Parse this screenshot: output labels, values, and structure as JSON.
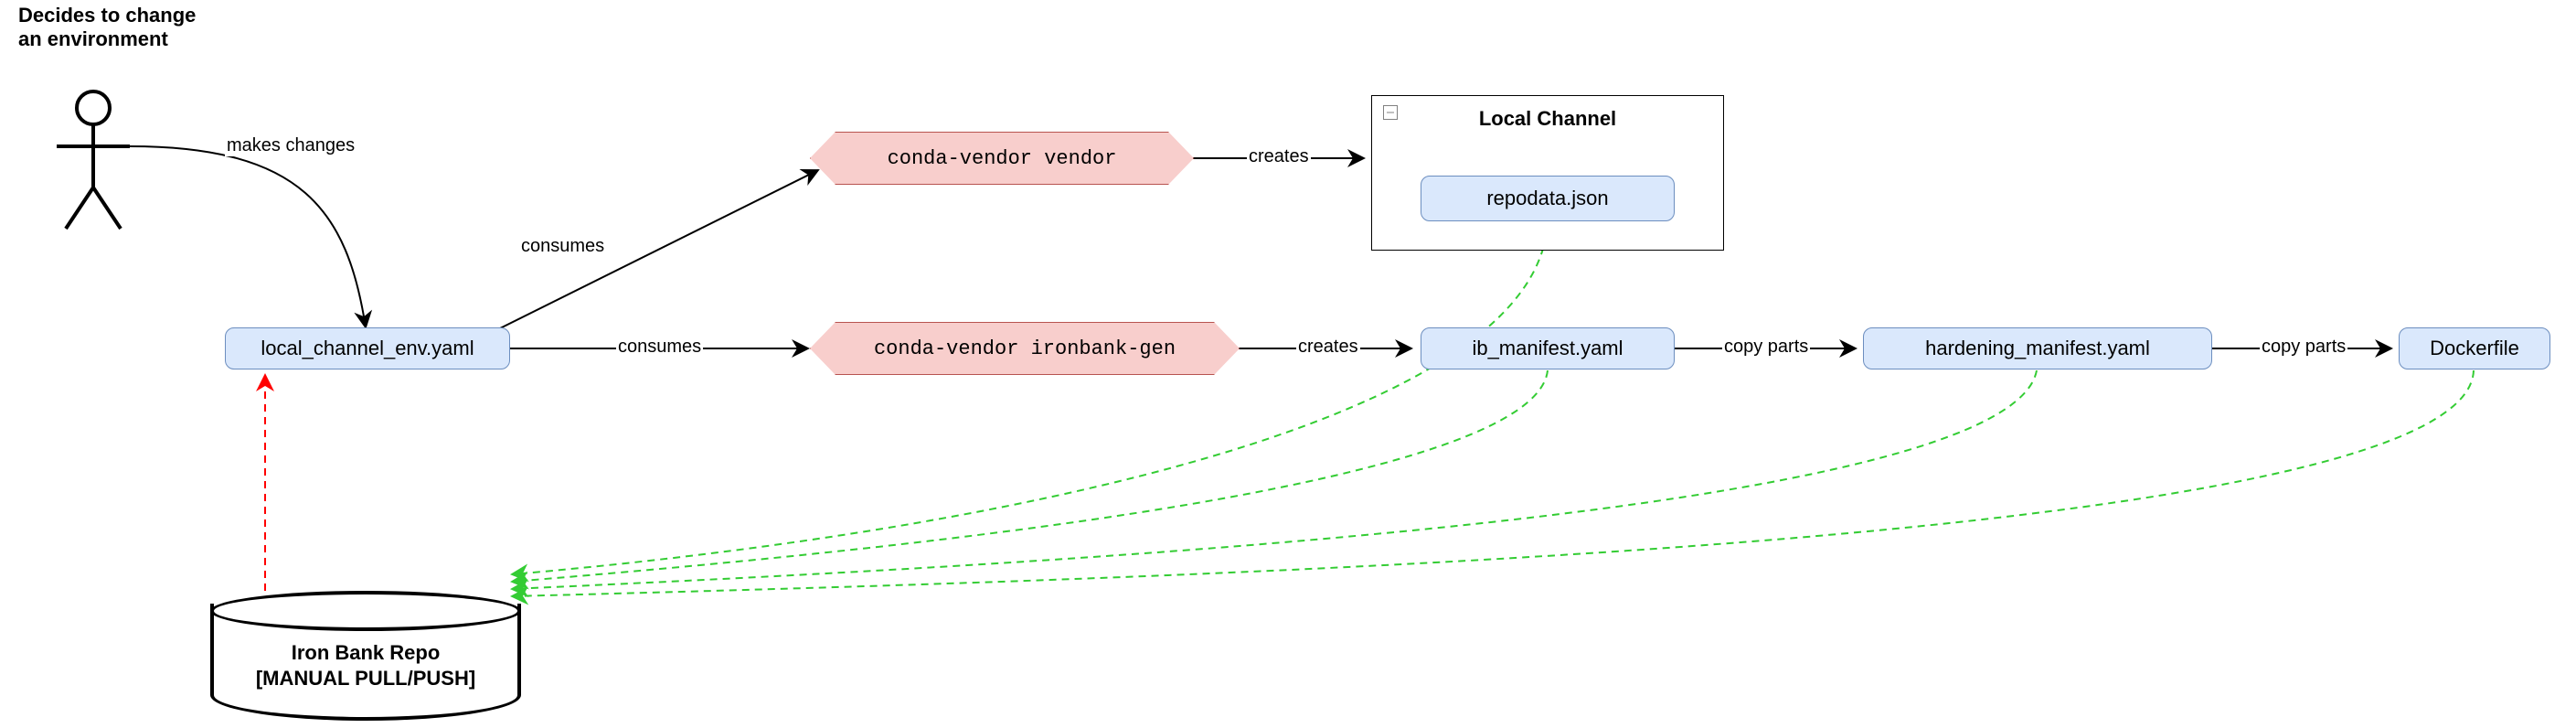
{
  "actor": {
    "title": "Decides to change\nan environment"
  },
  "nodes": {
    "local_channel_env": "local_channel_env.yaml",
    "vendor": "conda-vendor vendor",
    "ironbank_gen": "conda-vendor ironbank-gen",
    "local_channel_container": "Local Channel",
    "repodata": "repodata.json",
    "ib_manifest": "ib_manifest.yaml",
    "hardening_manifest": "hardening_manifest.yaml",
    "dockerfile": "Dockerfile",
    "iron_bank_repo": "Iron Bank Repo\n[MANUAL PULL/PUSH]"
  },
  "edges": {
    "makes_changes": "makes changes",
    "consumes1": "consumes",
    "consumes2": "consumes",
    "creates1": "creates",
    "creates2": "creates",
    "copy_parts1": "copy parts",
    "copy_parts2": "copy parts"
  }
}
